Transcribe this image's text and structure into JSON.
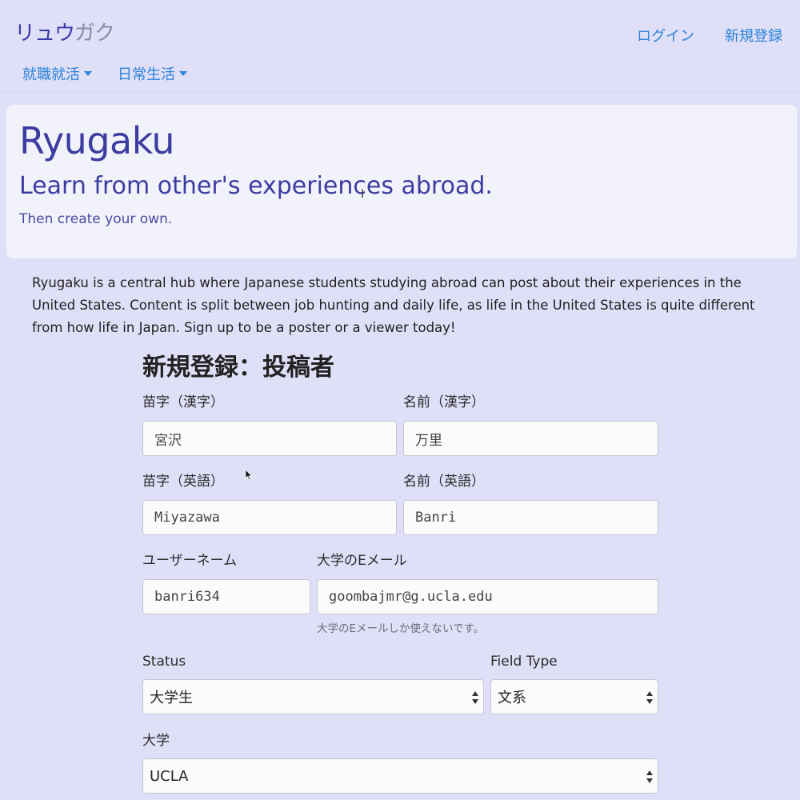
{
  "navbar": {
    "brand_part1": "リュウ",
    "brand_part2": "ガク",
    "login": "ログイン",
    "signup": "新規登録",
    "menu": [
      {
        "label": "就職就活"
      },
      {
        "label": "日常生活"
      }
    ]
  },
  "jumbotron": {
    "title": "Ryugaku",
    "lead": "Learn from other's experiences abroad.",
    "sub": "Then create your own."
  },
  "intro": "Ryugaku is a central hub where Japanese students studying abroad can post about their experiences in the United States. Content is split between job hunting and daily life, as life in the United States is quite different from how life in Japan. Sign up to be a poster or a viewer today!",
  "form": {
    "heading": "新規登録：投稿者",
    "last_name_kanji": {
      "label": "苗字（漢字）",
      "value": "宮沢"
    },
    "first_name_kanji": {
      "label": "名前（漢字）",
      "value": "万里"
    },
    "last_name_english": {
      "label": "苗字（英語）",
      "value": "Miyazawa"
    },
    "first_name_english": {
      "label": "名前（英語）",
      "value": "Banri"
    },
    "username": {
      "label": "ユーザーネーム",
      "value": "banri634"
    },
    "email": {
      "label": "大学のEメール",
      "value": "goombajmr@g.ucla.edu",
      "help": "大学のEメールしか使えないです。"
    },
    "status": {
      "label": "Status",
      "value": "大学生"
    },
    "field_type": {
      "label": "Field Type",
      "value": "文系"
    },
    "university": {
      "label": "大学",
      "value": "UCLA"
    }
  },
  "colors": {
    "background": "#dfdff8",
    "jumbotron": "#f2f2fb",
    "link": "#2a82d8",
    "brand_primary": "#3a3aa8",
    "brand_secondary": "#8a8aa6",
    "heading_accent": "#3d3da1"
  },
  "icons": {
    "dropdown": "caret-down-icon",
    "select_arrows": "up-down-arrows-icon",
    "mouse_pointer": "mouse-pointer-icon",
    "text_cursor": "text-cursor-icon"
  }
}
